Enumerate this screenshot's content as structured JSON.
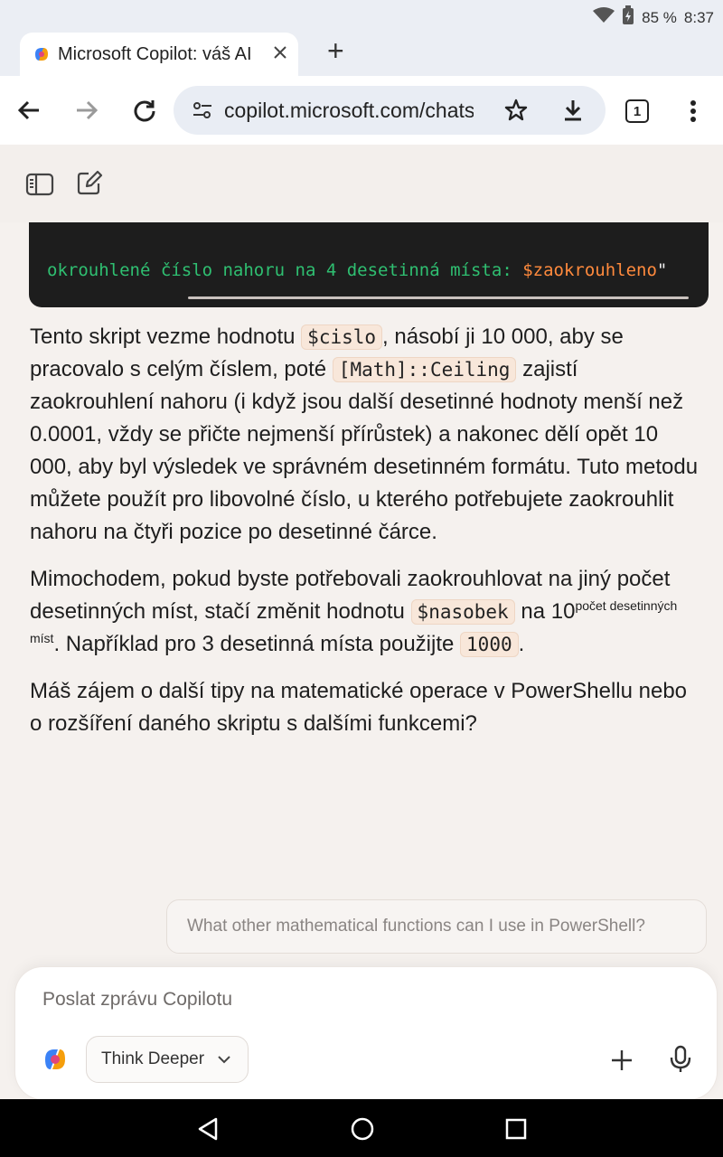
{
  "status_bar": {
    "battery": "85 %",
    "time": "8:37"
  },
  "browser": {
    "tab_title": "Microsoft Copilot: váš AI",
    "new_tab_symbol": "+",
    "url": "copilot.microsoft.com/chats",
    "tab_count": "1"
  },
  "code": {
    "text": "okrouhlené číslo nahoru na 4 desetinná místa: ",
    "variable": "$zaokrouhleno",
    "quote": "\""
  },
  "message": {
    "p1": {
      "t1": "Tento skript vezme hodnotu ",
      "c1": "$cislo",
      "t2": ", násobí ji 10 000, aby se pracovalo s celým číslem, poté ",
      "c2": "[Math]::Ceiling",
      "t3": " zajistí zaokrouhlení nahoru (i když jsou další desetinné hodnoty menší než 0.0001, vždy se přičte nejmenší přírůstek) a nakonec dělí opět 10 000, aby byl výsledek ve správném desetinném formátu. Tuto metodu můžete použít pro libovolné číslo, u kterého potřebujete zaokrouhlit nahoru na čtyři pozice po desetinné čárce."
    },
    "p2": {
      "t1": "Mimochodem, pokud byste potřebovali zaokrouhlovat na jiný počet desetinných míst, stačí změnit hodnotu ",
      "c1": "$nasobek",
      "t2": " na 10",
      "sup": "počet desetinných míst",
      "t3": ". Například pro 3 desetinná místa použijte ",
      "c2": "1000",
      "t4": "."
    },
    "p3": "Máš zájem o další tipy na matematické operace v PowerShellu nebo o rozšíření daného skriptu s dalšími funkcemi?"
  },
  "suggestion": "What other mathematical functions can I use in PowerShell?",
  "composer": {
    "placeholder": "Poslat zprávu Copilotu",
    "mode_label": "Think Deeper"
  },
  "colors": {
    "page_bg": "#f5f1ee",
    "code_bg": "#1d1d1d",
    "code_green": "#2fbf71",
    "code_orange": "#ff8a3d",
    "inline_code_bg": "#f8e7da"
  }
}
